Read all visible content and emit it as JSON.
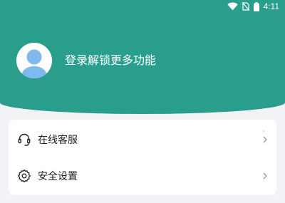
{
  "status_bar": {
    "time": "4:11",
    "icons": [
      "wifi-icon",
      "no-sim-icon",
      "battery-icon"
    ]
  },
  "header": {
    "background_color": "#2a9e8d",
    "login_text": "登录解锁更多功能",
    "avatar_icon": "person-avatar-icon"
  },
  "menu": {
    "items": [
      {
        "label": "在线客服",
        "icon": "headset-icon"
      },
      {
        "label": "安全设置",
        "icon": "gear-icon"
      }
    ]
  },
  "colors": {
    "accent": "#2a9e8d",
    "page_background": "#f2f3f7",
    "avatar_fill": "#7fb9ef"
  }
}
